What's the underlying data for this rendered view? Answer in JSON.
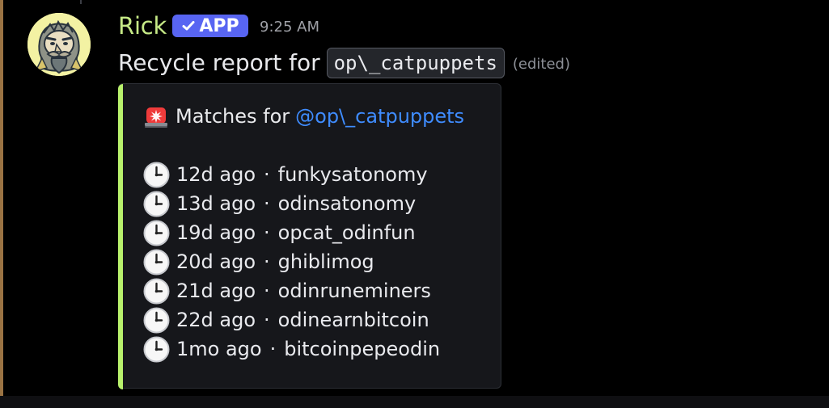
{
  "message": {
    "username": "Rick",
    "badge": "APP",
    "time": "9:25 AM",
    "text_prefix": "Recycle report for",
    "code": "op\\_catpuppets",
    "edited": "(edited)"
  },
  "embed": {
    "title_prefix": "Matches for",
    "title_mention": "@op\\_catpuppets",
    "separator": "·",
    "matches": [
      {
        "age": "12d ago",
        "name": "funkysatonomy"
      },
      {
        "age": "13d ago",
        "name": "odinsatonomy"
      },
      {
        "age": "19d ago",
        "name": "opcat_odinfun"
      },
      {
        "age": "20d ago",
        "name": "ghiblimog"
      },
      {
        "age": "21d ago",
        "name": "odinruneminers"
      },
      {
        "age": "22d ago",
        "name": "odinearnbitcoin"
      },
      {
        "age": "1mo ago",
        "name": "bitcoinpepeodin"
      }
    ]
  },
  "colors": {
    "username": "#c6ea86",
    "badge": "#5865f2",
    "embed_accent": "#b8f16c",
    "mention": "#3f8cff"
  },
  "icons": {
    "avatar": "wizard-avatar",
    "verified": "check-icon",
    "title": "siren-icon",
    "row": "clock-icon"
  }
}
